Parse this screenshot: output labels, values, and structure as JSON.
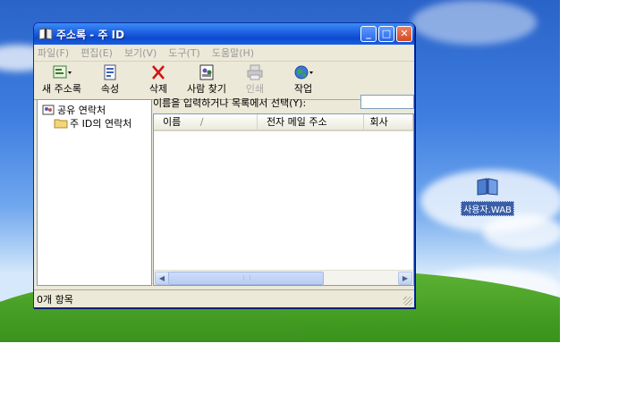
{
  "window": {
    "title": "주소록 - 주 ID",
    "minimize_symbol": "_",
    "maximize_symbol": "□",
    "close_symbol": "✕"
  },
  "menu": [
    "파일(F)",
    "편집(E)",
    "보기(V)",
    "도구(T)",
    "도움말(H)"
  ],
  "toolbar": {
    "new": "새 주소록",
    "properties": "속성",
    "delete": "삭제",
    "find": "사람 찾기",
    "print": "인쇄",
    "action": "작업"
  },
  "tree": {
    "shared": "공유 연락처",
    "main_id": "주 ID의 연락처"
  },
  "search": {
    "label": "이름을 입력하거나 목록에서 선택(Y):",
    "value": ""
  },
  "list": {
    "columns": [
      "이름",
      "전자 메일 주소",
      "회사"
    ],
    "sort_indicator": "/"
  },
  "statusbar": {
    "text": "0개 항목"
  },
  "desktop": {
    "icon_label": "사용자.WAB"
  },
  "colors": {
    "titlebar": "#1d5fe0",
    "window_bg": "#ece9d8",
    "close_button": "#d24a23"
  }
}
